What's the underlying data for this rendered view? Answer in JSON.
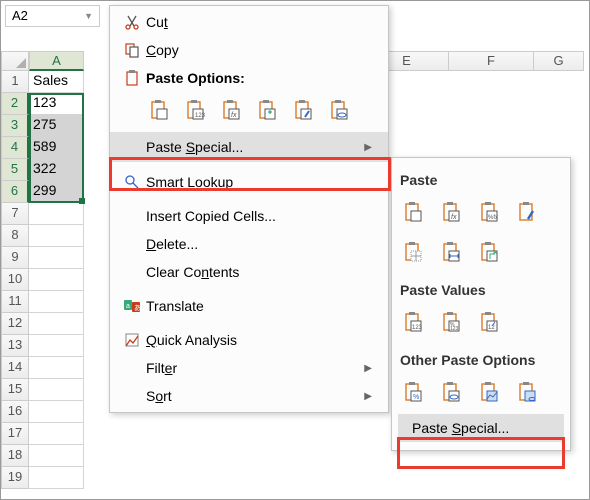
{
  "namebox": {
    "value": "A2"
  },
  "columns": [
    "A",
    "E",
    "F",
    "G"
  ],
  "rows": [
    "1",
    "2",
    "3",
    "4",
    "5",
    "6",
    "7",
    "8",
    "9",
    "10",
    "11",
    "12",
    "13",
    "14",
    "15",
    "16",
    "17",
    "18",
    "19"
  ],
  "cells": {
    "header": "Sales",
    "data": [
      "123",
      "275",
      "589",
      "322",
      "299"
    ]
  },
  "menu": {
    "cut": "Cut",
    "copy": "Copy",
    "paste_options": "Paste Options:",
    "paste_special": "Paste Special...",
    "smart_lookup": "Smart Lookup",
    "insert_copied": "Insert Copied Cells...",
    "delete": "Delete...",
    "clear_contents": "Clear Contents",
    "translate": "Translate",
    "quick_analysis": "Quick Analysis",
    "filter": "Filter",
    "sort": "Sort"
  },
  "submenu": {
    "paste": "Paste",
    "paste_values": "Paste Values",
    "other_paste": "Other Paste Options",
    "paste_special": "Paste Special..."
  }
}
